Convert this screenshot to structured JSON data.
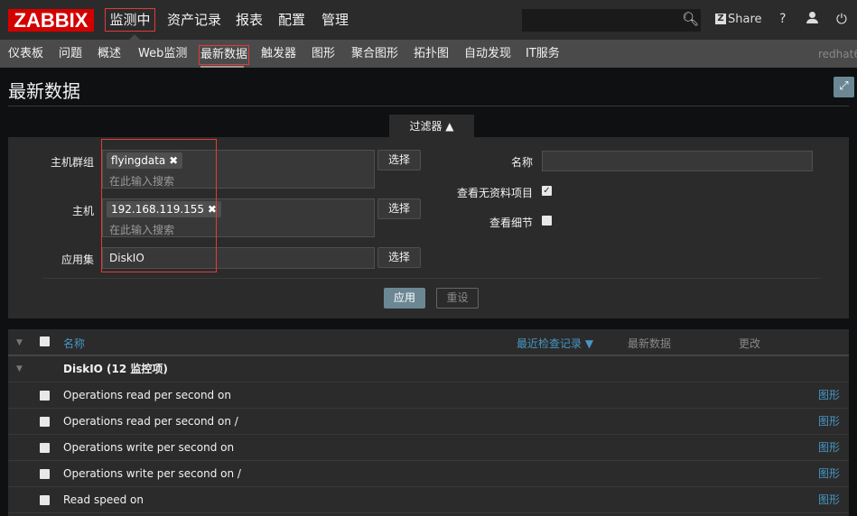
{
  "logo": "ZABBIX",
  "main_nav": [
    "监测中",
    "资产记录",
    "报表",
    "配置",
    "管理"
  ],
  "top_right": {
    "share": "Share",
    "help": "?"
  },
  "sub_nav": [
    "仪表板",
    "问题",
    "概述",
    "Web监测",
    "最新数据",
    "触发器",
    "图形",
    "聚合图形",
    "拓扑图",
    "自动发现",
    "IT服务"
  ],
  "server_name": "redhat6",
  "page_title": "最新数据",
  "filter": {
    "tab_label": "过滤器 ▲",
    "host_groups_label": "主机群组",
    "host_groups_tag": "flyingdata",
    "hosts_label": "主机",
    "hosts_tag": "192.168.119.155",
    "search_placeholder": "在此输入搜索",
    "application_label": "应用集",
    "application_value": "DiskIO",
    "select_label": "选择",
    "name_label": "名称",
    "name_value": "",
    "show_without_data_label": "查看无资料项目",
    "show_without_data": true,
    "show_details_label": "查看细节",
    "show_details": false,
    "apply": "应用",
    "reset": "重设"
  },
  "table": {
    "headers": {
      "name": "名称",
      "last_check": "最近检查记录 ▼",
      "last_value": "最新数据",
      "change": "更改"
    },
    "group": "DiskIO (12 监控项)",
    "rows": [
      {
        "name": "Operations read per second on",
        "link": "图形"
      },
      {
        "name": "Operations read per second on /",
        "link": "图形"
      },
      {
        "name": "Operations write per second on",
        "link": "图形"
      },
      {
        "name": "Operations write per second on /",
        "link": "图形"
      },
      {
        "name": "Read speed on",
        "link": "图形"
      }
    ]
  },
  "colors": {
    "brand": "#d40000",
    "highlight": "#e33a3a",
    "link": "#4796c4",
    "apply_button": "#6b8794"
  }
}
